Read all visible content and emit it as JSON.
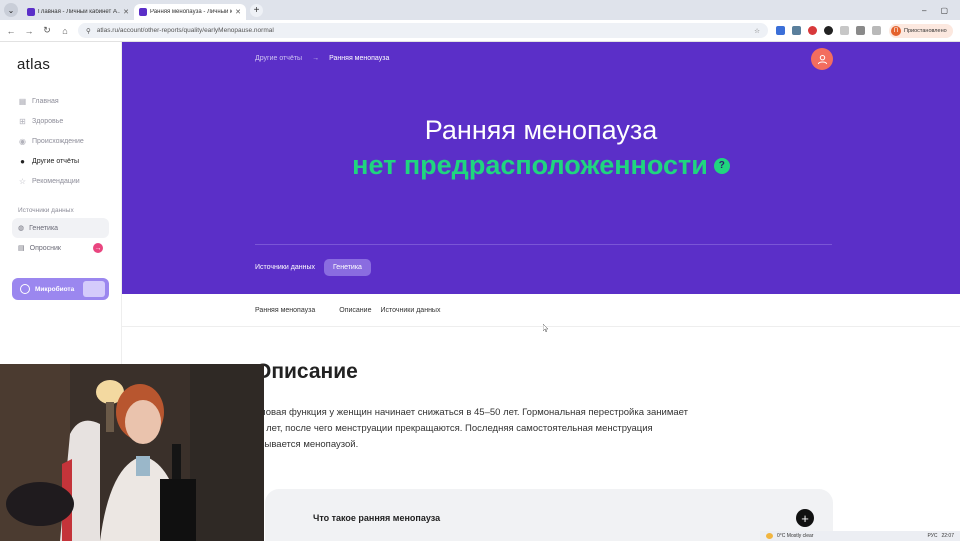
{
  "browser": {
    "tabs": [
      {
        "title": "Главная - Личный кабинет A…",
        "active": false,
        "favicon_color": "#5b2fc8"
      },
      {
        "title": "Ранняя менопауза - Личный к…",
        "active": true,
        "favicon_color": "#5b2fc8"
      }
    ],
    "new_tab_label": "+",
    "url": "atlas.ru/account/other-reports/quality/earlyMenopause.normal",
    "profile_label": "Приостановлено",
    "profile_initial": "П"
  },
  "sidebar": {
    "logo": "atlas",
    "nav": [
      {
        "label": "Главная",
        "icon": "grid-icon",
        "glyph": "▦",
        "active": false
      },
      {
        "label": "Здоровье",
        "icon": "first-aid-icon",
        "glyph": "⊞",
        "active": false
      },
      {
        "label": "Происхождение",
        "icon": "location-icon",
        "glyph": "◉",
        "active": false
      },
      {
        "label": "Другие отчёты",
        "icon": "person-icon",
        "glyph": "●",
        "active": true
      },
      {
        "label": "Рекомендации",
        "icon": "star-icon",
        "glyph": "☆",
        "active": false
      }
    ],
    "sources_label": "Источники данных",
    "sources": [
      {
        "label": "Генетика",
        "icon": "dna-icon",
        "glyph": "◍",
        "selected": true
      },
      {
        "label": "Опросник",
        "icon": "clipboard-icon",
        "glyph": "▤",
        "selected": false
      }
    ],
    "microbiota_label": "Микробиота"
  },
  "hero": {
    "breadcrumb_parent": "Другие отчёты",
    "breadcrumb_sep": "→",
    "breadcrumb_current": "Ранняя менопауза",
    "title": "Ранняя менопауза",
    "status": "нет предрасположенности",
    "status_help": "?",
    "sources_label": "Источники данных",
    "source_chip": "Генетика",
    "accent": "#5b2fc8",
    "status_color": "#20d57f"
  },
  "anchors": {
    "first": "Ранняя менопауза",
    "items": [
      "Описание",
      "Источники данных"
    ]
  },
  "description": {
    "title": "Описание",
    "line1": "оловая функция у женщин начинает снижаться в 45–50 лет. Гормональная перестройка занимает",
    "line2": "-8 лет, после чего менструации прекращаются. Последняя самостоятельная менструация",
    "line3": "азывается менопаузой."
  },
  "faq": {
    "question": "Что такое ранняя менопауза",
    "toggle": "+"
  },
  "taskbar": {
    "weather": "0°C  Mostly clear",
    "lang": "РУС",
    "time": "22:07"
  }
}
